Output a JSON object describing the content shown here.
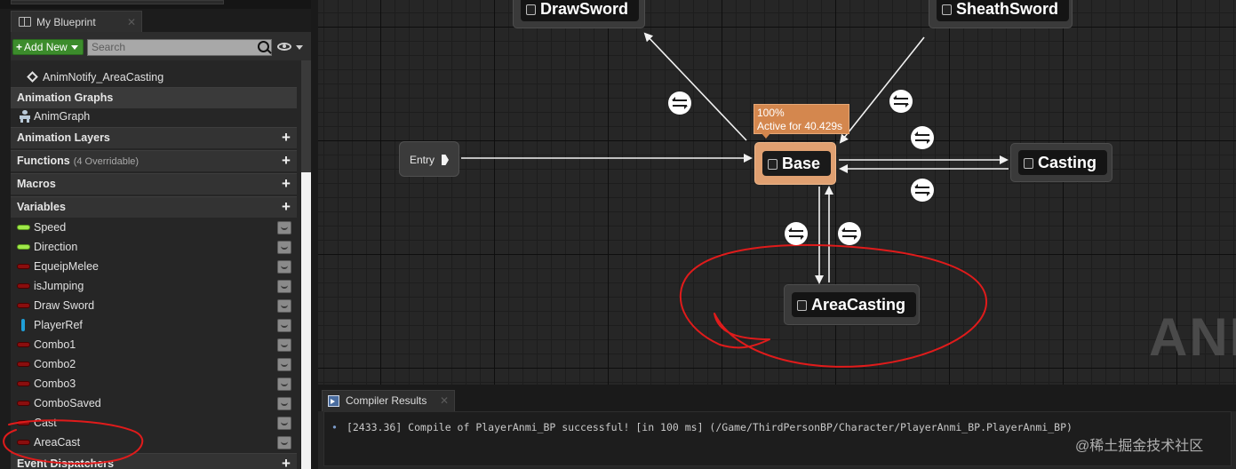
{
  "left_panel": {
    "tab_title": "My Blueprint",
    "add_new_label": "Add New",
    "search_placeholder": "Search",
    "tree_items": [
      {
        "label": "AnimNotify_AreaCasting"
      },
      {
        "label": "AnimGraph"
      }
    ],
    "categories": {
      "animation_graphs": "Animation Graphs",
      "animation_layers": "Animation Layers",
      "functions": "Functions",
      "functions_sub": "(4 Overridable)",
      "macros": "Macros",
      "variables": "Variables",
      "event_dispatchers": "Event Dispatchers"
    },
    "variables": [
      {
        "name": "Speed",
        "type": "float"
      },
      {
        "name": "Direction",
        "type": "float"
      },
      {
        "name": "EqueipMelee",
        "type": "bool"
      },
      {
        "name": "isJumping",
        "type": "bool"
      },
      {
        "name": "Draw Sword",
        "type": "bool"
      },
      {
        "name": "PlayerRef",
        "type": "object"
      },
      {
        "name": "Combo1",
        "type": "bool"
      },
      {
        "name": "Combo2",
        "type": "bool"
      },
      {
        "name": "Combo3",
        "type": "bool"
      },
      {
        "name": "ComboSaved",
        "type": "bool"
      },
      {
        "name": "Cast",
        "type": "bool"
      },
      {
        "name": "AreaCast",
        "type": "bool"
      }
    ]
  },
  "graph": {
    "states": {
      "draw_sword": "DrawSword",
      "sheath_sword": "SheathSword",
      "base": "Base",
      "casting": "Casting",
      "area_casting": "AreaCasting"
    },
    "entry_label": "Entry",
    "tooltip_percent": "100%",
    "tooltip_active": "Active for 40.429s",
    "watermark": "ANI"
  },
  "compiler": {
    "tab_label": "Compiler Results",
    "log_line": "[2433.36] Compile of PlayerAnmi_BP successful! [in 100 ms] (/Game/ThirdPersonBP/Character/PlayerAnmi_BP.PlayerAnmi_BP)"
  },
  "credit": "@稀土掘金技术社区",
  "colors": {
    "active_state": "#e0a071",
    "float_pin": "#a0e84a",
    "bool_pin": "#8a0e0e",
    "object_pin": "#1f9fd8",
    "annotation": "#e01b1b",
    "add_new": "#3c8c2c"
  }
}
